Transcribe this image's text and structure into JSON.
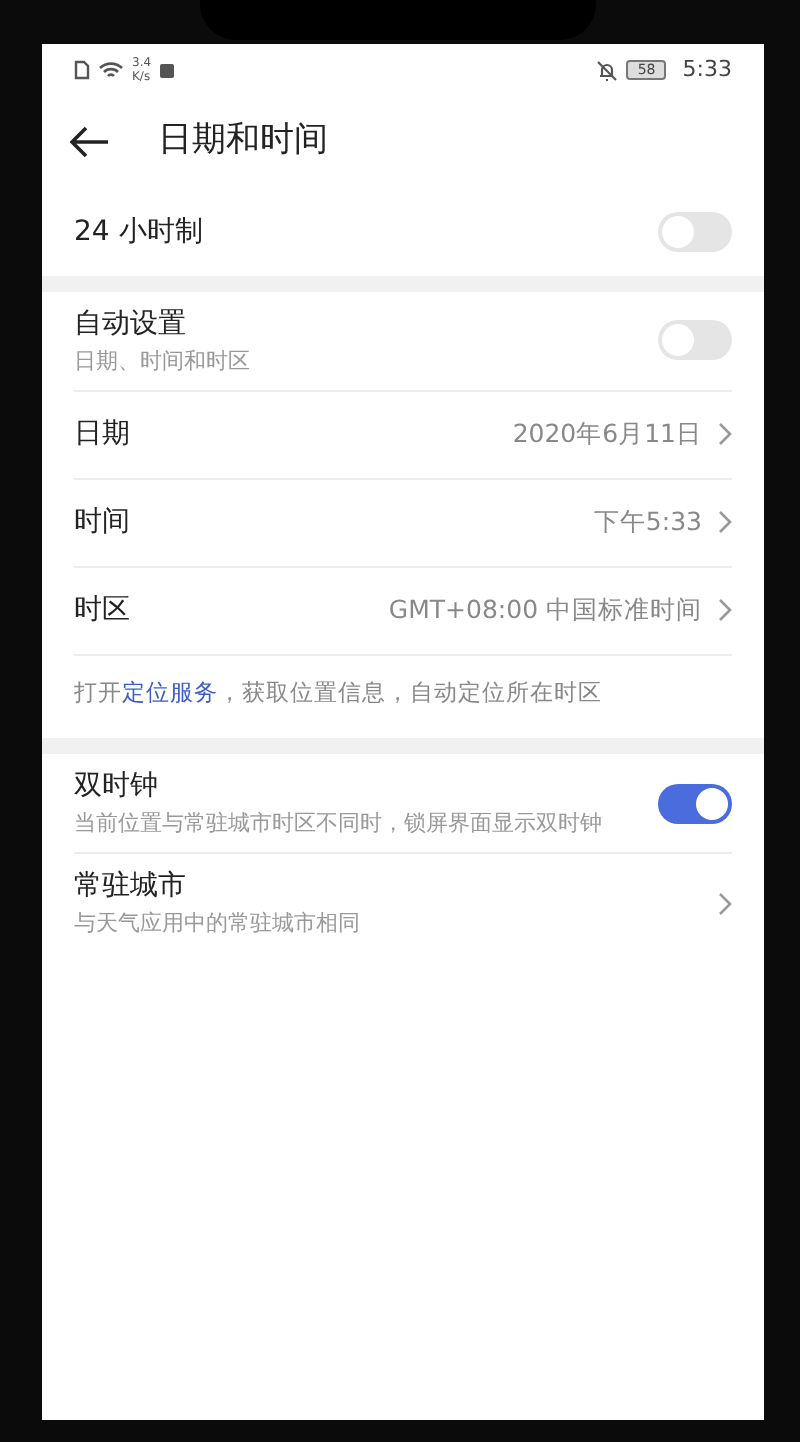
{
  "status_bar": {
    "speed": "3.4",
    "speed_unit": "K/s",
    "battery": "58",
    "time": "5:33"
  },
  "header": {
    "title": "日期和时间"
  },
  "sections": [
    {
      "items": [
        {
          "kind": "switch",
          "label": "24 小时制",
          "on": false
        }
      ]
    },
    {
      "items": [
        {
          "kind": "switch",
          "label": "自动设置",
          "sublabel": "日期、时间和时区",
          "on": false
        },
        {
          "kind": "link",
          "label": "日期",
          "value": "2020年6月11日"
        },
        {
          "kind": "link",
          "label": "时间",
          "value": "下午5:33"
        },
        {
          "kind": "link",
          "label": "时区",
          "value": "GMT+08:00 中国标准时间"
        }
      ],
      "note": {
        "before": "打开",
        "link": "定位服务",
        "after": "，获取位置信息，自动定位所在时区"
      }
    },
    {
      "items": [
        {
          "kind": "switch",
          "label": "双时钟",
          "sublabel": "当前位置与常驻城市时区不同时，锁屏界面显示双时钟",
          "on": true
        },
        {
          "kind": "link",
          "label": "常驻城市",
          "sublabel": "与天气应用中的常驻城市相同"
        }
      ]
    }
  ]
}
